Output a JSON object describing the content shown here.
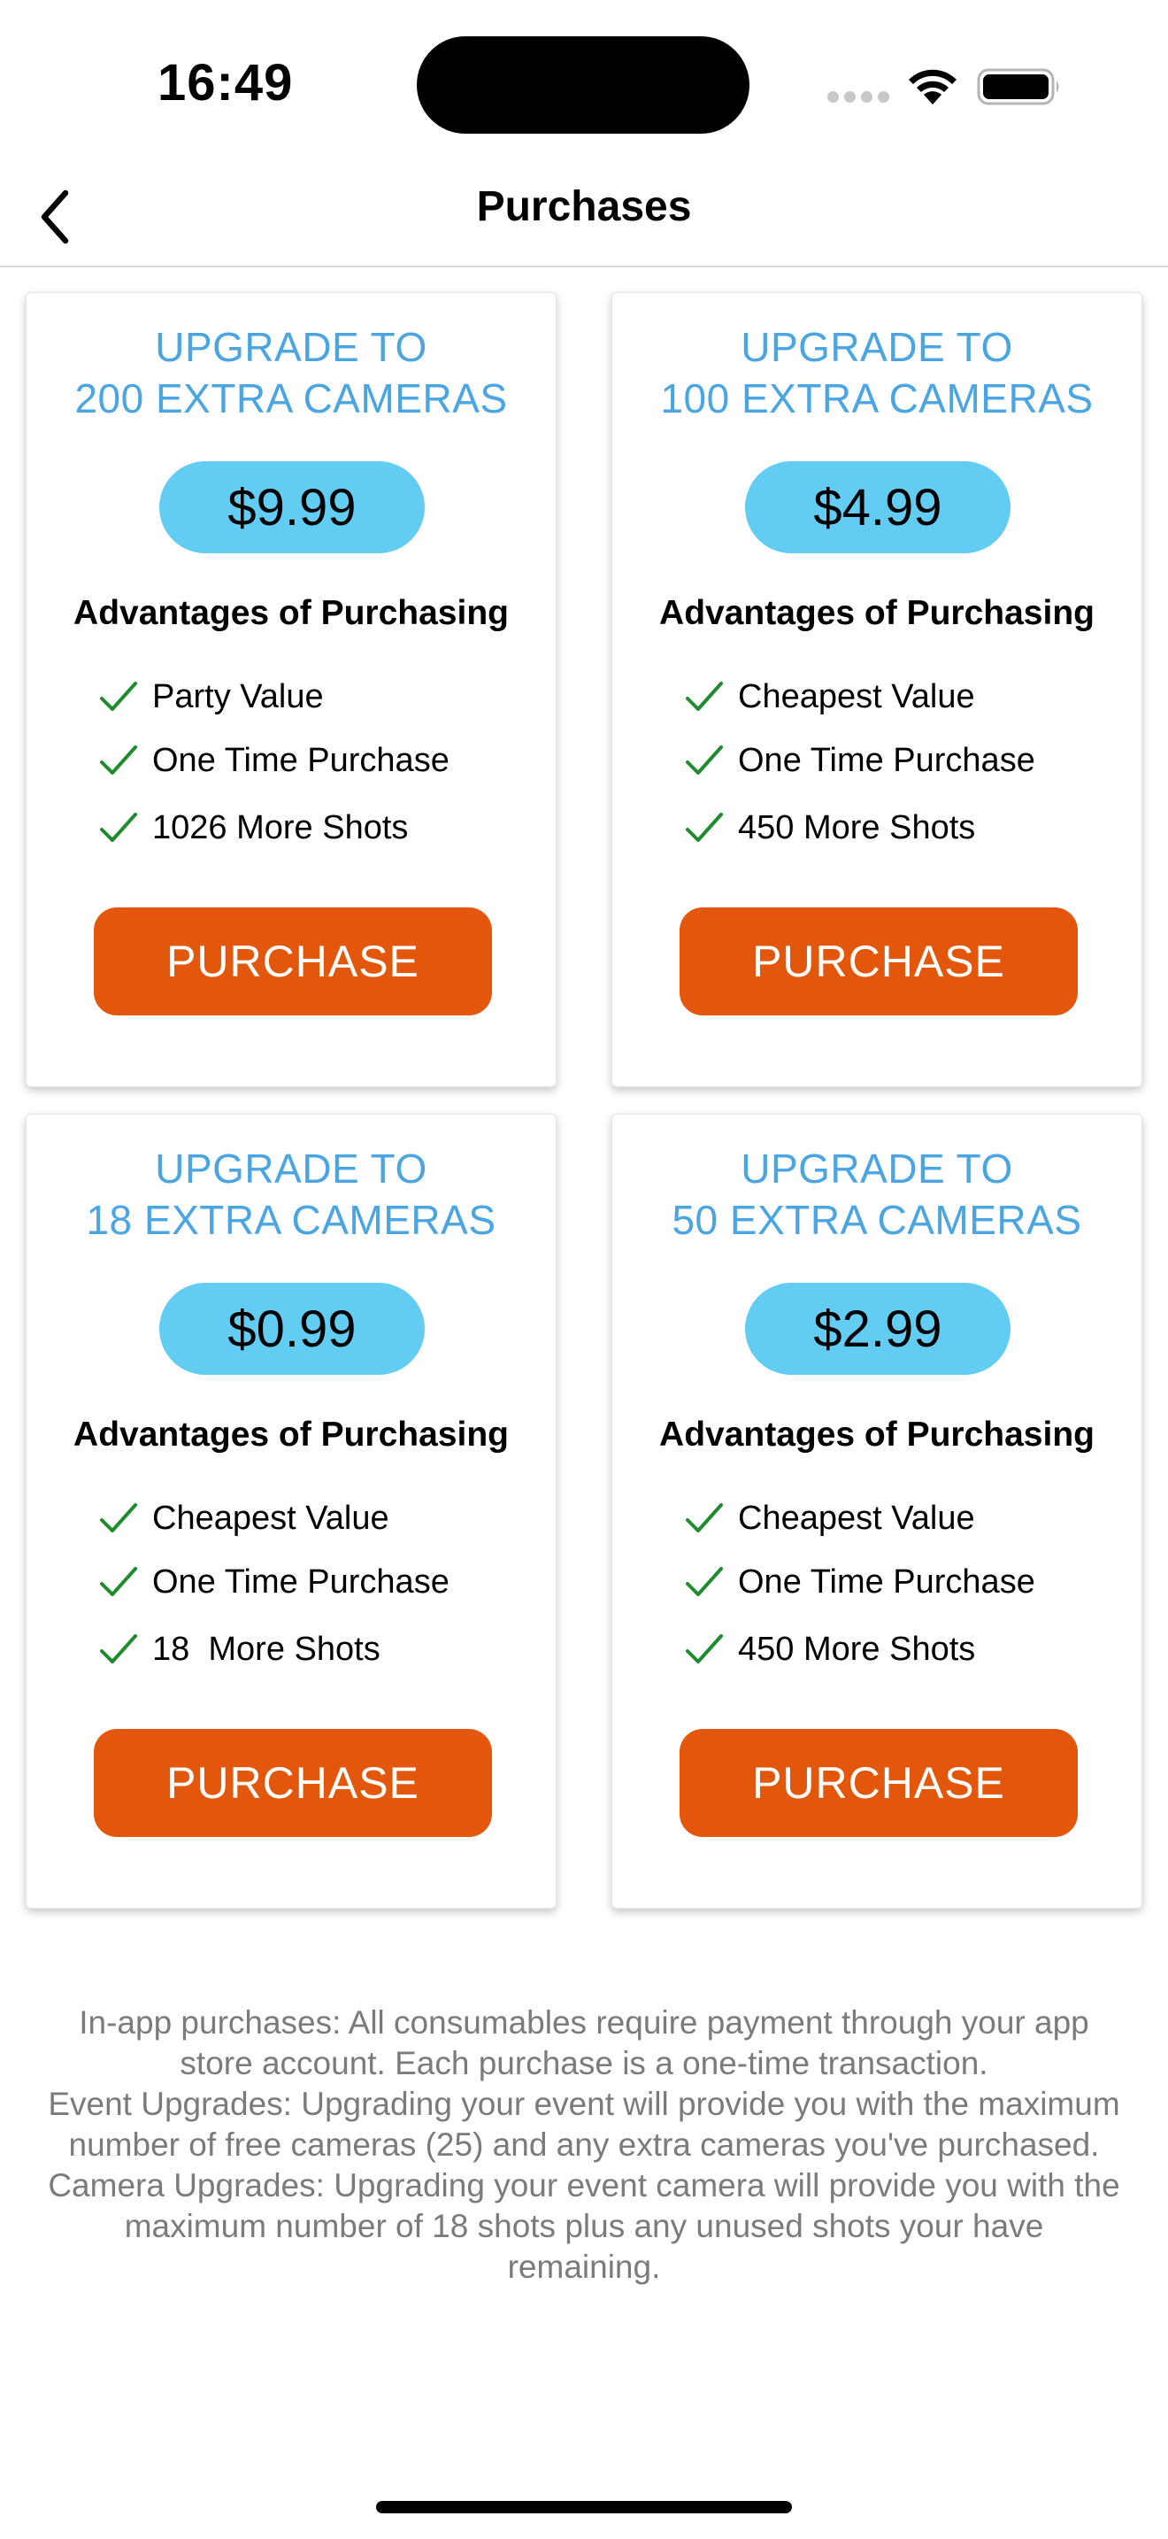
{
  "status_bar": {
    "time": "16:49",
    "icons": [
      "signal-dots-icon",
      "wifi-icon",
      "battery-icon"
    ]
  },
  "nav": {
    "back_icon": "chevron-left-icon",
    "title": "Purchases"
  },
  "colors": {
    "title_blue": "#4aa5e0",
    "price_pill": "#63ccf2",
    "purchase_orange": "#e2570b",
    "check_green": "#1f8a2e",
    "footer_gray": "#7b7b7b"
  },
  "cards": [
    {
      "title_line1": "UPGRADE TO",
      "title_line2": "200 EXTRA CAMERAS",
      "price": "$9.99",
      "advantages_heading": "Advantages of Purchasing",
      "advantages": [
        "Party Value",
        "One Time Purchase",
        "1026 More Shots"
      ],
      "button_label": "PURCHASE"
    },
    {
      "title_line1": "UPGRADE TO",
      "title_line2": "100 EXTRA CAMERAS",
      "price": "$4.99",
      "advantages_heading": "Advantages of Purchasing",
      "advantages": [
        "Cheapest Value",
        "One Time Purchase",
        "450 More Shots"
      ],
      "button_label": "PURCHASE"
    },
    {
      "title_line1": "UPGRADE TO",
      "title_line2": "18 EXTRA CAMERAS",
      "price": "$0.99",
      "advantages_heading": "Advantages of Purchasing",
      "advantages": [
        "Cheapest Value",
        "One Time Purchase",
        "18  More Shots"
      ],
      "button_label": "PURCHASE"
    },
    {
      "title_line1": "UPGRADE TO",
      "title_line2": "50 EXTRA CAMERAS",
      "price": "$2.99",
      "advantages_heading": "Advantages of Purchasing",
      "advantages": [
        "Cheapest Value",
        "One Time Purchase",
        "450 More Shots"
      ],
      "button_label": "PURCHASE"
    }
  ],
  "footer": {
    "line1": "In-app purchases: All consumables require payment through your app store account. Each purchase is a one-time transaction.",
    "line2": "Event Upgrades: Upgrading your event will provide you with the maximum number of free cameras (25) and any extra cameras you've purchased.",
    "line3": "Camera Upgrades: Upgrading your event camera will provide you with the maximum number of 18 shots plus any unused shots your have remaining."
  }
}
